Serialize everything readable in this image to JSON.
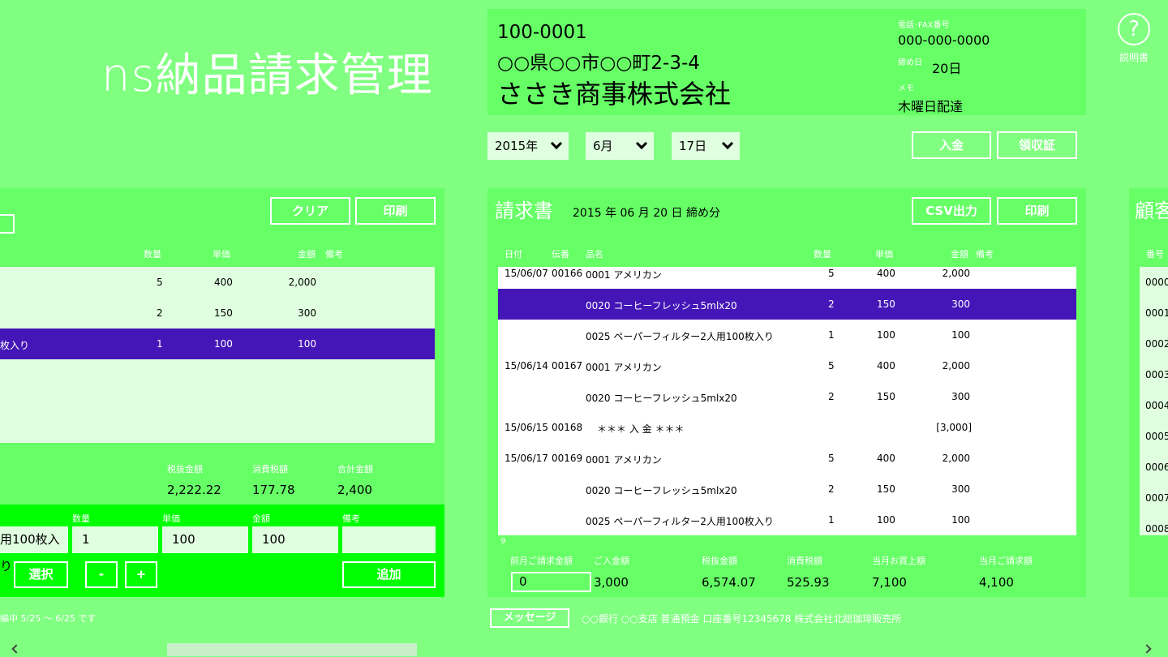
{
  "app": {
    "title": "ns納品請求管理",
    "help_label": "説明書",
    "help_glyph": "?"
  },
  "customer": {
    "zip": "100-0001",
    "address": "○○県○○市○○町2-3-4",
    "name": "ささき商事株式会社",
    "phone_label": "電話･FAX番号",
    "phone": "000-000-0000",
    "closing_label": "締め日",
    "closing": "20日",
    "memo_label": "メモ",
    "memo": "木曜日配達"
  },
  "date": {
    "year": "2015年",
    "month": "6月",
    "day": "17日"
  },
  "top_buttons": {
    "payment": "入金",
    "receipt": "領収証"
  },
  "delivery": {
    "clear": "クリア",
    "print": "印刷",
    "headers": {
      "qty": "数量",
      "price": "単価",
      "amount": "金額",
      "note": "備考"
    },
    "rows": [
      {
        "name": "",
        "qty": "5",
        "price": "400",
        "amount": "2,000"
      },
      {
        "name": "",
        "qty": "2",
        "price": "150",
        "amount": "300"
      },
      {
        "name": "枚入り",
        "qty": "1",
        "price": "100",
        "amount": "100"
      }
    ],
    "totals": {
      "subtotal_label": "税抜金額",
      "subtotal": "2,222.22",
      "tax_label": "消費税額",
      "tax": "177.78",
      "total_label": "合計金額",
      "total": "2,400"
    },
    "entry": {
      "qty_label": "数量",
      "price_label": "単価",
      "amount_label": "金額",
      "note_label": "備考",
      "item": "用100枚入り",
      "qty": "1",
      "price": "100",
      "amount": "100",
      "note": "",
      "select": "選択",
      "minus": "-",
      "plus": "+",
      "add": "追加"
    },
    "footer": "編中 5/25 ～ 6/25 です"
  },
  "invoice": {
    "title": "請求書",
    "period": "2015 年 06 月 20 日 締め分",
    "csv": "CSV出力",
    "print": "印刷",
    "headers": {
      "date": "日付",
      "slip": "伝番",
      "item": "品名",
      "qty": "数量",
      "price": "単価",
      "amount": "金額",
      "note": "備考"
    },
    "rows": [
      {
        "date": "15/06/07",
        "slip": "00166",
        "item": "0001 アメリカン",
        "qty": "5",
        "price": "400",
        "amount": "2,000"
      },
      {
        "date": "",
        "slip": "",
        "item": "0020 コーヒーフレッシュ5mlx20",
        "qty": "2",
        "price": "150",
        "amount": "300"
      },
      {
        "date": "",
        "slip": "",
        "item": "0025 ペーパーフィルター2人用100枚入り",
        "qty": "1",
        "price": "100",
        "amount": "100"
      },
      {
        "date": "15/06/14",
        "slip": "00167",
        "item": "0001 アメリカン",
        "qty": "5",
        "price": "400",
        "amount": "2,000"
      },
      {
        "date": "",
        "slip": "",
        "item": "0020 コーヒーフレッシュ5mlx20",
        "qty": "2",
        "price": "150",
        "amount": "300"
      },
      {
        "date": "15/06/15",
        "slip": "00168",
        "item": "＊＊＊ 入 金 ＊＊＊",
        "qty": "",
        "price": "",
        "amount": "[3,000]"
      },
      {
        "date": "15/06/17",
        "slip": "00169",
        "item": "0001 アメリカン",
        "qty": "5",
        "price": "400",
        "amount": "2,000"
      },
      {
        "date": "",
        "slip": "",
        "item": "0020 コーヒーフレッシュ5mlx20",
        "qty": "2",
        "price": "150",
        "amount": "300"
      },
      {
        "date": "",
        "slip": "",
        "item": "0025 ペーパーフィルター2人用100枚入り",
        "qty": "1",
        "price": "100",
        "amount": "100"
      }
    ],
    "count": "9",
    "totals": {
      "prev_label": "前月ご請求金額",
      "prev": "0",
      "paid_label": "ご入金額",
      "paid": "3,000",
      "subtotal_label": "税抜金額",
      "subtotal": "6,574.07",
      "tax_label": "消費税額",
      "tax": "525.93",
      "sales_label": "当月お買上額",
      "sales": "7,100",
      "billed_label": "当月ご請求額",
      "billed": "4,100"
    },
    "message_btn": "メッセージ",
    "message": "○○銀行 ○○支店 普通預金 口座番号12345678 株式会社北総珈琲販売所"
  },
  "customers": {
    "title": "顧客",
    "header": "番号",
    "rows": [
      "0000",
      "0001",
      "0002",
      "0003",
      "0004",
      "0005",
      "0006",
      "0007",
      "0008"
    ]
  },
  "colors": {
    "background": "#80ff80",
    "panel": "#66ff66",
    "selection": "#4416b7",
    "entry_bar": "#00ff00"
  }
}
